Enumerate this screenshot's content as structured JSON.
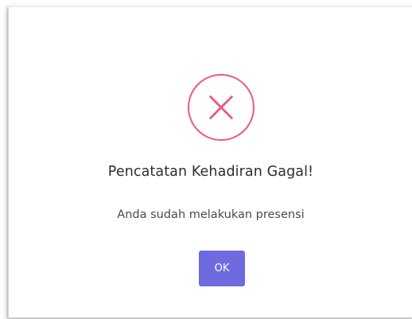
{
  "dialog": {
    "icon": "error-x-icon",
    "icon_color": "#ec5a7a",
    "title": "Pencatatan Kehadiran Gagal!",
    "message": "Anda sudah melakukan presensi",
    "ok_label": "OK",
    "ok_color": "#6e6ae0"
  }
}
